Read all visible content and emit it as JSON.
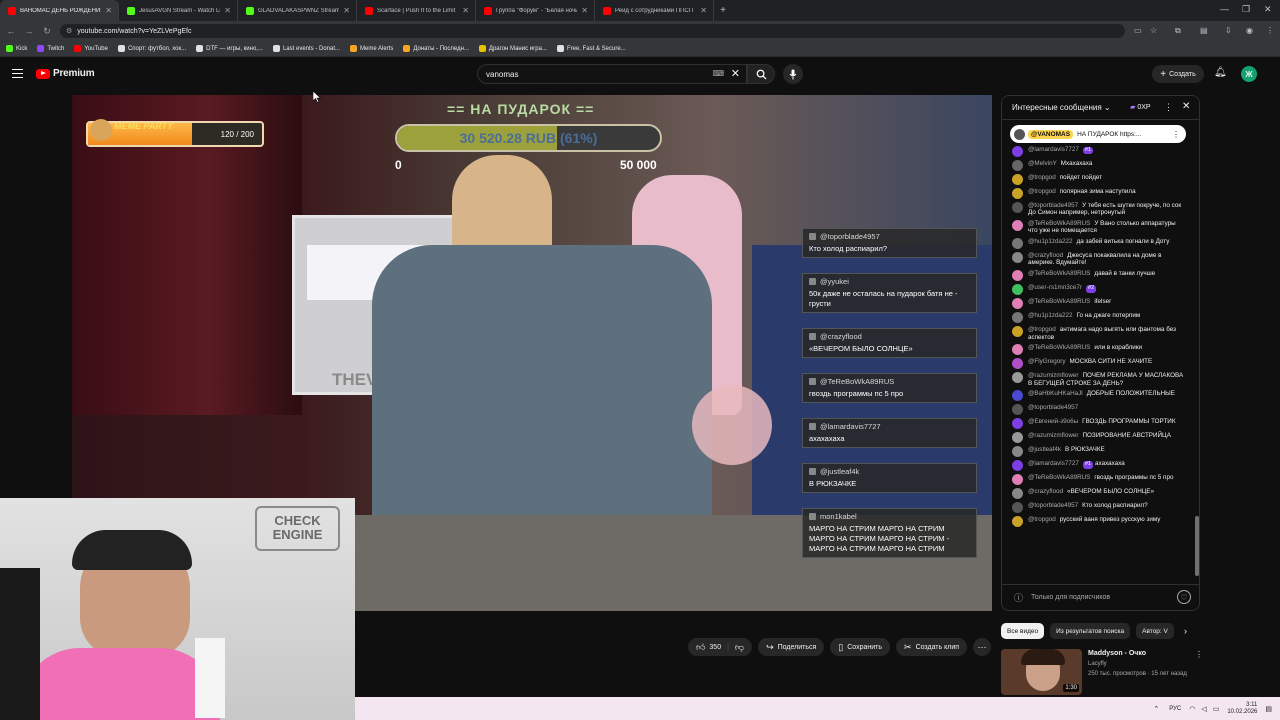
{
  "browser": {
    "tabs": [
      {
        "title": "ВАНОМАС ДЕНЬ РОЖДЕНИЯ",
        "favicon_color": "#ff0000",
        "active": true
      },
      {
        "title": "JesusAVGN Stream - Watch Live",
        "favicon_color": "#53fc18",
        "active": false
      },
      {
        "title": "GLADVALAKASPWNZ Stream",
        "favicon_color": "#53fc18",
        "active": false
      },
      {
        "title": "Scarface | Push It to the Limit",
        "favicon_color": "#ff0000",
        "active": false
      },
      {
        "title": "Группа \"Форум\" - \"Белая ночь\"",
        "favicon_color": "#ff0000",
        "active": false
      },
      {
        "title": "Рейд с сотрудниками ППСП",
        "favicon_color": "#ff0000",
        "active": false
      }
    ],
    "new_tab_label": "+",
    "url": "youtube.com/watch?v=YeZLVePgEfc",
    "bookmarks": [
      {
        "label": "Kick",
        "color": "#53fc18"
      },
      {
        "label": "Twitch",
        "color": "#9146ff"
      },
      {
        "label": "YouTube",
        "color": "#ff0000"
      },
      {
        "label": "Спорт: футбол, хок...",
        "color": "#e0e0e0"
      },
      {
        "label": "DTF — игры, кино,...",
        "color": "#e0e0e0"
      },
      {
        "label": "Last events - Donat...",
        "color": "#e0e0e0"
      },
      {
        "label": "Meme Alerts",
        "color": "#f5a623"
      },
      {
        "label": "Донаты - Последн...",
        "color": "#f5a623"
      },
      {
        "label": "Драгон Манис игра...",
        "color": "#e6c200"
      },
      {
        "label": "Free, Fast & Secure...",
        "color": "#e0e0e0"
      }
    ]
  },
  "youtube": {
    "logo_text": "Premium",
    "search_value": "vanomas",
    "create_label": "Создать",
    "avatar_letter": "Ж"
  },
  "video_overlay": {
    "meme_label": "MEME PARTY",
    "meme_value": "120 / 200",
    "meme_progress": 0.6,
    "goal_title": "== НА ПУДАРОК ==",
    "goal_amount": "30 520.28 RUB (61%)",
    "goal_progress": 0.61,
    "goal_min": "0",
    "goal_max": "50 000",
    "stream_messages": [
      {
        "user": "@toporblade4957",
        "text": "Кто холод распиарил?"
      },
      {
        "user": "@yyukei",
        "text": "50к даже не осталась на пударок батя не - грусти"
      },
      {
        "user": "@crazyflood",
        "text": "«ВЕЧЕРОМ БЫЛО СОЛНЦЕ»"
      },
      {
        "user": "@TeReBoWkA89RUS",
        "text": "гвоздь программы пс 5 про"
      },
      {
        "user": "@lamardavis7727",
        "text": "ахахахаха"
      },
      {
        "user": "@justleaf4k",
        "text": "В РЮКЗАЧКЕ"
      },
      {
        "user": "mon1kabel",
        "text": "МАРГО НА СТРИМ МАРГО НА СТРИМ МАРГО НА СТРИМ МАРГО НА СТРИМ - МАРГО НА СТРИМ МАРГО НА СТРИМ"
      }
    ],
    "wall_text": "THEVANOMA"
  },
  "webcam": {
    "sign_text": "CHECK ENGINE"
  },
  "actions": {
    "like_count": "350",
    "share_label": "Поделиться",
    "save_label": "Сохранить",
    "clip_label": "Создать клип"
  },
  "chat": {
    "header_title": "Интересные сообщения",
    "points": "0XP",
    "pinned_user": "@VANOMAS",
    "pinned_text": "НА ПУДАРОК https:...",
    "messages": [
      {
        "author": "@lamardavis7727",
        "text": "",
        "badge": "#1",
        "color": "#7b3fe4"
      },
      {
        "author": "@MelvinY",
        "text": "Мхахахаха",
        "badge": "",
        "color": "#666666"
      },
      {
        "author": "@tropgod",
        "text": "пойдет пойдет",
        "badge": "",
        "color": "#c9a227"
      },
      {
        "author": "@tropgod",
        "text": "полярная зима наступила",
        "badge": "",
        "color": "#c9a227"
      },
      {
        "author": "@toporblade4957",
        "text": "У тебя есть шутки покруче, по сок До Симон например, нетронутый",
        "badge": "",
        "color": "#555555"
      },
      {
        "author": "@TeReBoWkA89RUS",
        "text": "У Вано столько аппаратуры что уже не помещается",
        "badge": "",
        "color": "#e07fb5"
      },
      {
        "author": "@hu1p1zda222",
        "text": "да забей витька погнали в Доту",
        "badge": "",
        "color": "#777777"
      },
      {
        "author": "@crazyflood",
        "text": "Джесуса покаквалила на доме в америке. Вдумайте!",
        "badge": "",
        "color": "#888888"
      },
      {
        "author": "@TeReBoWkA89RUS",
        "text": "давай в танки лучше",
        "badge": "",
        "color": "#e07fb5"
      },
      {
        "author": "@user-rs1mn3ce7r",
        "text": "",
        "badge": "#2",
        "color": "#3fbf5f"
      },
      {
        "author": "@TeReBoWkA89RUS",
        "text": "ifelser",
        "badge": "",
        "color": "#e07fb5"
      },
      {
        "author": "@hu1p1zda222",
        "text": "Го на джаге потерпим",
        "badge": "",
        "color": "#777777"
      },
      {
        "author": "@tropgod",
        "text": "антимага надо выгять или фантома без аспектов",
        "badge": "",
        "color": "#c9a227"
      },
      {
        "author": "@TeReBoWkA89RUS",
        "text": "или в кораблики",
        "badge": "",
        "color": "#e07fb5"
      },
      {
        "author": "@FlyGregory",
        "text": "МОСКВА СИТИ НЕ ХАЧИТЕ",
        "badge": "",
        "color": "#b04fc8"
      },
      {
        "author": "@razumizmflower",
        "text": "ПОЧЕМ РЕКЛАМА У МАСЛАКОВА В БЕГУЩЕЙ СТРОКЕ ЗА ДЕНЬ?",
        "badge": "",
        "color": "#999999"
      },
      {
        "author": "@BaHbKuHKaHaJl",
        "text": "ДОБРЫЕ ПОЛОЖИТЕЛЬНЫЕ",
        "badge": "",
        "color": "#4a4ad0"
      },
      {
        "author": "@toporblade4957",
        "text": "",
        "badge": "",
        "color": "#555555"
      },
      {
        "author": "@Евгений-з9о6ы",
        "text": "ГВОЗДЬ ПРОГРАММЫ ТОРТИК",
        "badge": "",
        "color": "#7b3fe4"
      },
      {
        "author": "@razumizmflower",
        "text": "ПОЗИРОВАНИЕ АВСТРИЙЦА",
        "badge": "",
        "color": "#999999"
      },
      {
        "author": "@justleaf4k",
        "text": "В РЮКЗАЧКЕ",
        "badge": "",
        "color": "#888888"
      },
      {
        "author": "@lamardavis7727",
        "text": "ахахахаха",
        "badge": "#1",
        "color": "#7b3fe4"
      },
      {
        "author": "@TeReBoWkA89RUS",
        "text": "гвоздь программы пс 5 про",
        "badge": "",
        "color": "#e07fb5"
      },
      {
        "author": "@crazyflood",
        "text": "«ВЕЧЕРОМ БЫЛО СОЛНЦЕ»",
        "badge": "",
        "color": "#888888"
      },
      {
        "author": "@toporblade4957",
        "text": "Кто холод распиарил?",
        "badge": "",
        "color": "#555555"
      },
      {
        "author": "@tropgod",
        "text": "русский ваня привез русскую зиму",
        "badge": "",
        "color": "#c9a227"
      }
    ],
    "footer_text": "Только для подписчиков"
  },
  "recs": {
    "chips": [
      "Все видео",
      "Из результатов поиска",
      "Автор: V"
    ],
    "video_title": "Maddyson - Очко",
    "channel": "Lacyfly",
    "meta": "250 тыс. просмотров · 15 лет назад",
    "duration": "1:30"
  },
  "taskbar": {
    "lang": "РУС",
    "time": "3:11",
    "date": "10.02.2026"
  }
}
